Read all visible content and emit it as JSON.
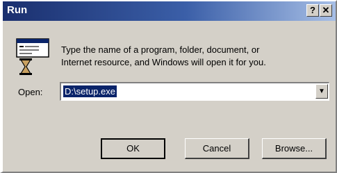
{
  "window": {
    "title": "Run",
    "help_label": "?",
    "close_label": "✕"
  },
  "dialog": {
    "prompt_line1": "Type the name of a program, folder, document, or",
    "prompt_line2": "Internet resource, and Windows will open it for you.",
    "open_label": "Open:",
    "open_value": "D:\\setup.exe",
    "dropdown_glyph": "▼"
  },
  "buttons": {
    "ok": "OK",
    "cancel": "Cancel",
    "browse": "Browse..."
  },
  "colors": {
    "titlebar_start": "#1a2f6e",
    "titlebar_end": "#a7bfe6",
    "dialog_face": "#d4d0c8",
    "selection": "#0a246a"
  }
}
